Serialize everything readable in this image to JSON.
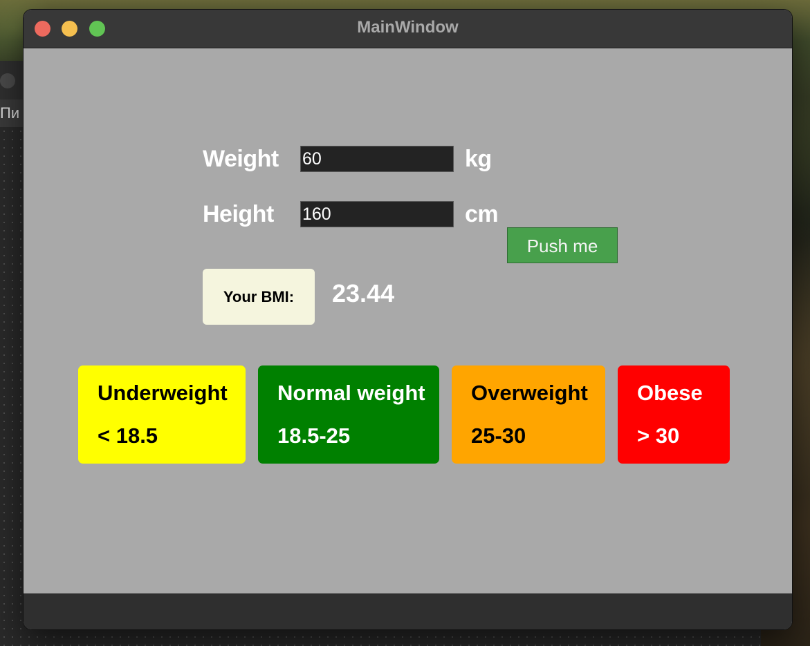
{
  "window": {
    "title": "MainWindow"
  },
  "background_window": {
    "menu_text": "Пи"
  },
  "form": {
    "weight_label": "Weight",
    "weight_value": "60",
    "weight_unit": "kg",
    "height_label": "Height",
    "height_value": "160",
    "height_unit": "cm",
    "button_label": "Push me"
  },
  "result": {
    "label": "Your BMI:",
    "value": "23.44"
  },
  "categories": [
    {
      "name": "Underweight",
      "range": "< 18.5",
      "color": "#ffff00",
      "text_color": "#000000"
    },
    {
      "name": "Normal weight",
      "range": "18.5-25",
      "color": "#008000",
      "text_color": "#ffffff"
    },
    {
      "name": "Overweight",
      "range": "25-30",
      "color": "#ffa500",
      "text_color": "#000000"
    },
    {
      "name": "Obese",
      "range": "> 30",
      "color": "#ff0000",
      "text_color": "#ffffff"
    }
  ],
  "colors": {
    "window_bg": "#a9a9a9",
    "button": "#48a04c",
    "bmi_box": "#f5f5de"
  }
}
